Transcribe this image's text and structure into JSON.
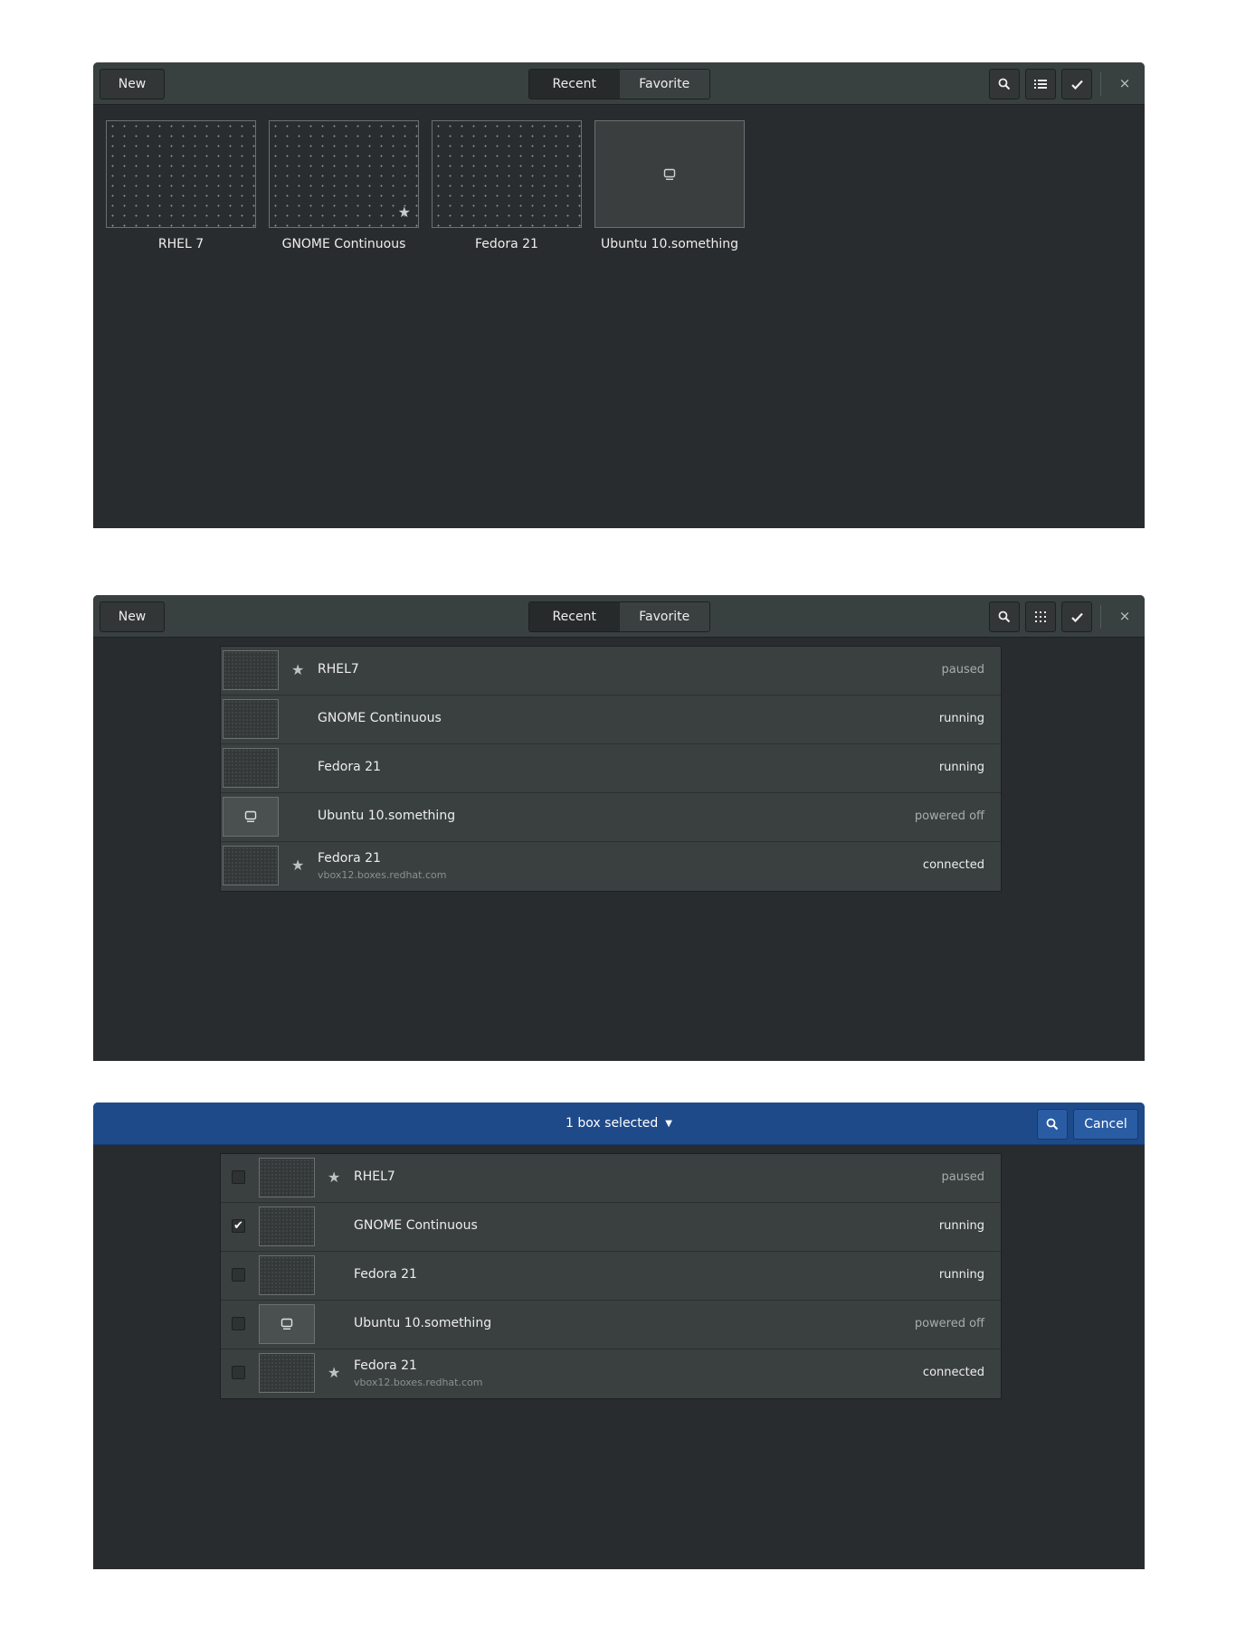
{
  "header": {
    "new_label": "New",
    "tabs": [
      "Recent",
      "Favorite"
    ],
    "close_glyph": "×"
  },
  "grid_view": {
    "tiles": [
      {
        "name": "RHEL 7",
        "favorite": false,
        "thumbnail": "dotted"
      },
      {
        "name": "GNOME Continuous",
        "favorite": true,
        "thumbnail": "dotted"
      },
      {
        "name": "Fedora 21",
        "favorite": false,
        "thumbnail": "dotted"
      },
      {
        "name": "Ubuntu 10.something",
        "favorite": false,
        "thumbnail": "monitor-icon"
      }
    ]
  },
  "list_view": {
    "rows": [
      {
        "name": "RHEL7",
        "sub": "",
        "favorite": true,
        "status": "paused"
      },
      {
        "name": "GNOME Continuous",
        "sub": "",
        "favorite": false,
        "status": "running"
      },
      {
        "name": "Fedora 21",
        "sub": "",
        "favorite": false,
        "status": "running"
      },
      {
        "name": "Ubuntu 10.something",
        "sub": "",
        "favorite": false,
        "status": "powered off"
      },
      {
        "name": "Fedora 21",
        "sub": "vbox12.boxes.redhat.com",
        "favorite": true,
        "status": "connected"
      }
    ]
  },
  "selection_view": {
    "title": "1 box selected",
    "cancel_label": "Cancel",
    "checked": [
      false,
      true,
      false,
      false,
      false
    ]
  },
  "colors": {
    "headerbar": "#394040",
    "content": "#292c2e",
    "selection_headerbar": "#1e4a8a"
  }
}
